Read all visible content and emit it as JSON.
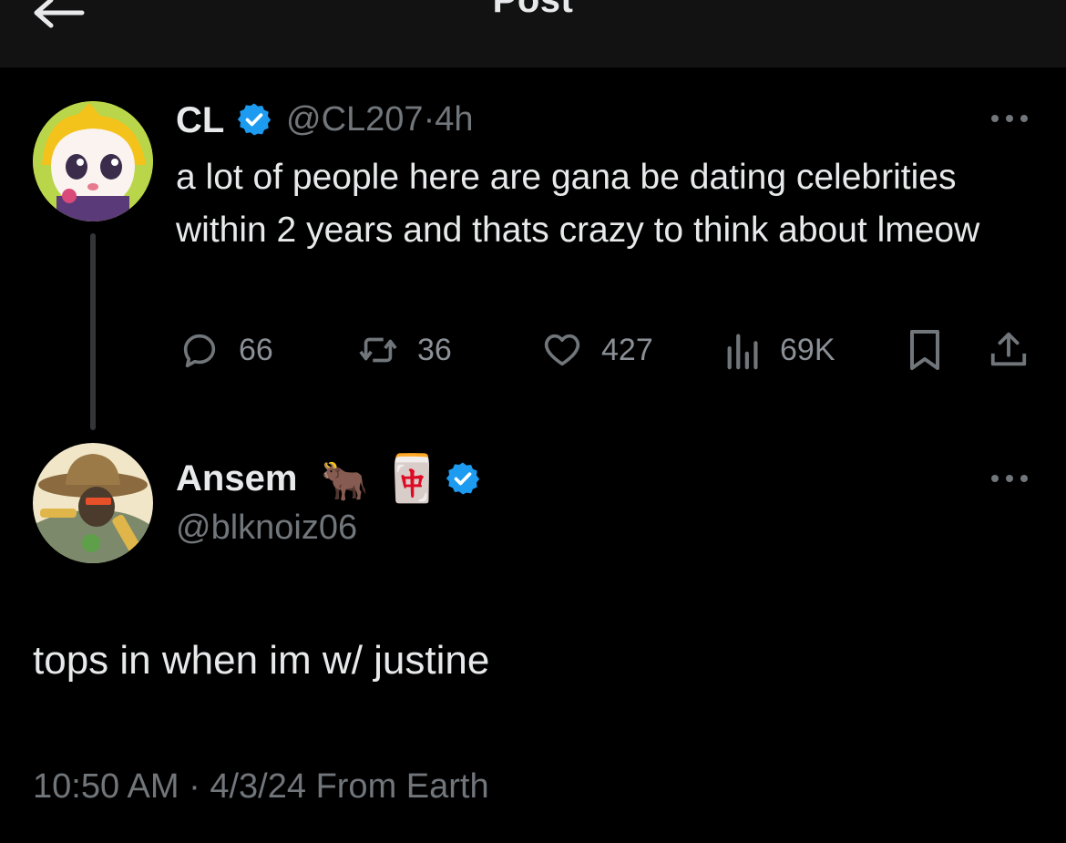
{
  "header": {
    "title": "Post",
    "back_icon": "arrow-left-icon"
  },
  "original_post": {
    "display_name": "CL",
    "handle": "@CL207",
    "separator": "·",
    "time_ago": "4h",
    "verified_icon": "verified-badge-icon",
    "more_icon": "more-horizontal-icon",
    "text": "a lot of people here are gana be dating celebrities within 2 years and thats crazy to think about lmeow",
    "actions": {
      "replies": "66",
      "reposts": "36",
      "likes": "427",
      "views": "69K"
    },
    "icons": {
      "reply": "reply-icon",
      "repost": "repost-icon",
      "like": "heart-icon",
      "views": "views-chart-icon",
      "bookmark": "bookmark-icon",
      "share": "share-icon"
    }
  },
  "reply_post": {
    "display_name": "Ansem",
    "emojis": [
      "🐂",
      "🀄"
    ],
    "handle": "@blknoiz06",
    "verified_icon": "verified-badge-icon",
    "more_icon": "more-horizontal-icon",
    "text": "tops in when im w/ justine",
    "timestamp": "10:50 AM",
    "separator": "·",
    "date": "4/3/24",
    "source": "From Earth"
  },
  "colors": {
    "background": "#000000",
    "header_bg": "#121212",
    "text_primary": "#e7e9ea",
    "text_secondary": "#71767b",
    "verified_blue": "#1d9bf0",
    "thread_line": "#333639"
  }
}
